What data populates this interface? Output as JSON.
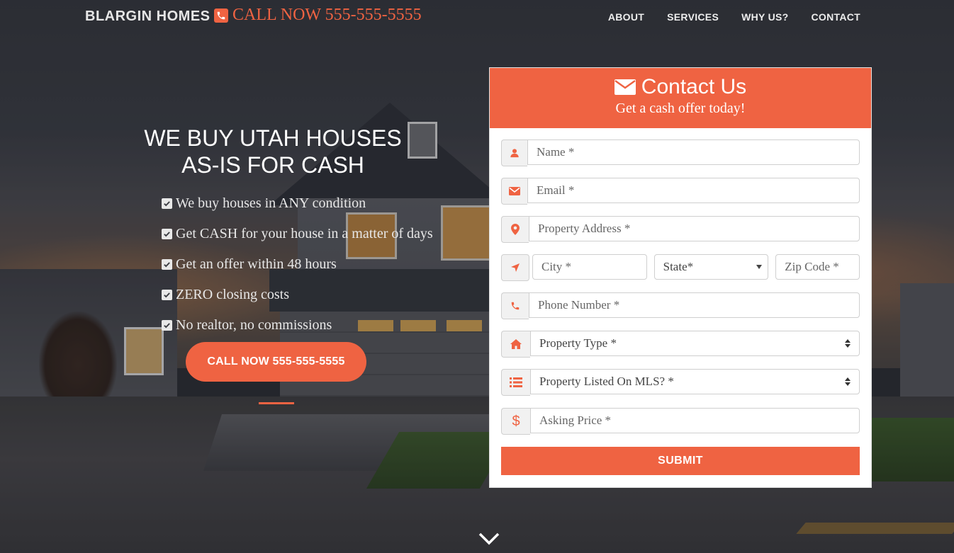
{
  "brand": {
    "name": "BLARGIN HOMES",
    "call_label": "CALL NOW 555-555-5555"
  },
  "nav": {
    "links": [
      "ABOUT",
      "SERVICES",
      "WHY US?",
      "CONTACT"
    ]
  },
  "hero": {
    "title_line1": "WE BUY UTAH HOUSES",
    "title_line2": "AS-IS FOR CASH",
    "features": [
      "We buy houses in ANY condition",
      "Get CASH for your house in a matter of days",
      "Get an offer within 48 hours",
      "ZERO closing costs",
      "No realtor, no commissions"
    ],
    "cta_label": "CALL NOW 555-555-5555"
  },
  "form": {
    "title": "Contact Us",
    "subtitle": "Get a cash offer today!",
    "name_placeholder": "Name *",
    "email_placeholder": "Email *",
    "address_placeholder": "Property Address *",
    "city_placeholder": "City *",
    "state_value": "State*",
    "zip_placeholder": "Zip Code *",
    "phone_placeholder": "Phone Number *",
    "property_type_value": "Property Type *",
    "mls_value": "Property Listed On MLS? *",
    "price_placeholder": "Asking Price *",
    "submit_label": "SUBMIT"
  },
  "icons": {
    "brand_phone": "phone-icon",
    "form_title": "envelope-icon",
    "name": "user-icon",
    "email": "envelope-icon",
    "address": "map-marker-icon",
    "city": "location-arrow-icon",
    "phone": "phone-icon",
    "type": "home-icon",
    "mls": "list-icon",
    "price": "dollar-icon",
    "scroll": "chevron-down-icon"
  },
  "colors": {
    "accent": "#ef6342",
    "nav_text": "#ededed",
    "card_bg": "#ffffff"
  }
}
